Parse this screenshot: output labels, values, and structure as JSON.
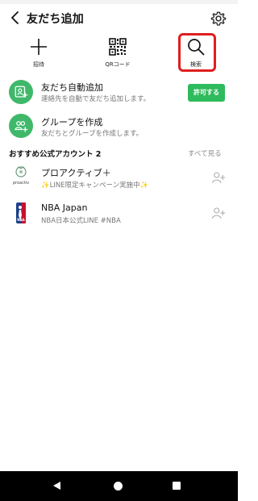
{
  "header": {
    "title": "友だち追加",
    "back_icon": "chevron-left-icon",
    "settings_icon": "gear-icon"
  },
  "actions": [
    {
      "label": "招待",
      "icon": "plus-icon"
    },
    {
      "label": "QRコード",
      "icon": "qr-code-icon"
    },
    {
      "label": "検索",
      "icon": "search-icon"
    }
  ],
  "auto_add": {
    "title": "友だち自動追加",
    "subtitle": "連絡先を自動で友だち追加します。",
    "button_label": "許可する",
    "icon": "person-add-icon"
  },
  "create_group": {
    "title": "グループを作成",
    "subtitle": "友だちとグループを作成します。",
    "icon": "group-add-icon"
  },
  "recommended": {
    "title": "おすすめ公式アカウント 2",
    "see_all": "すべて見る",
    "accounts": [
      {
        "name": "プロアクティブ＋",
        "description": "✨LINE限定キャンペーン実施中✨",
        "logo_text": "proactiv"
      },
      {
        "name": "NBA Japan",
        "description": "NBA日本公式LINE #NBA",
        "logo_text": "NBA"
      }
    ]
  },
  "colors": {
    "accent_green": "#2fbb5d",
    "highlight_red": "#e01e1e"
  },
  "nav": {
    "back_icon": "triangle-back-icon",
    "home_icon": "circle-home-icon",
    "recents_icon": "square-recents-icon"
  }
}
